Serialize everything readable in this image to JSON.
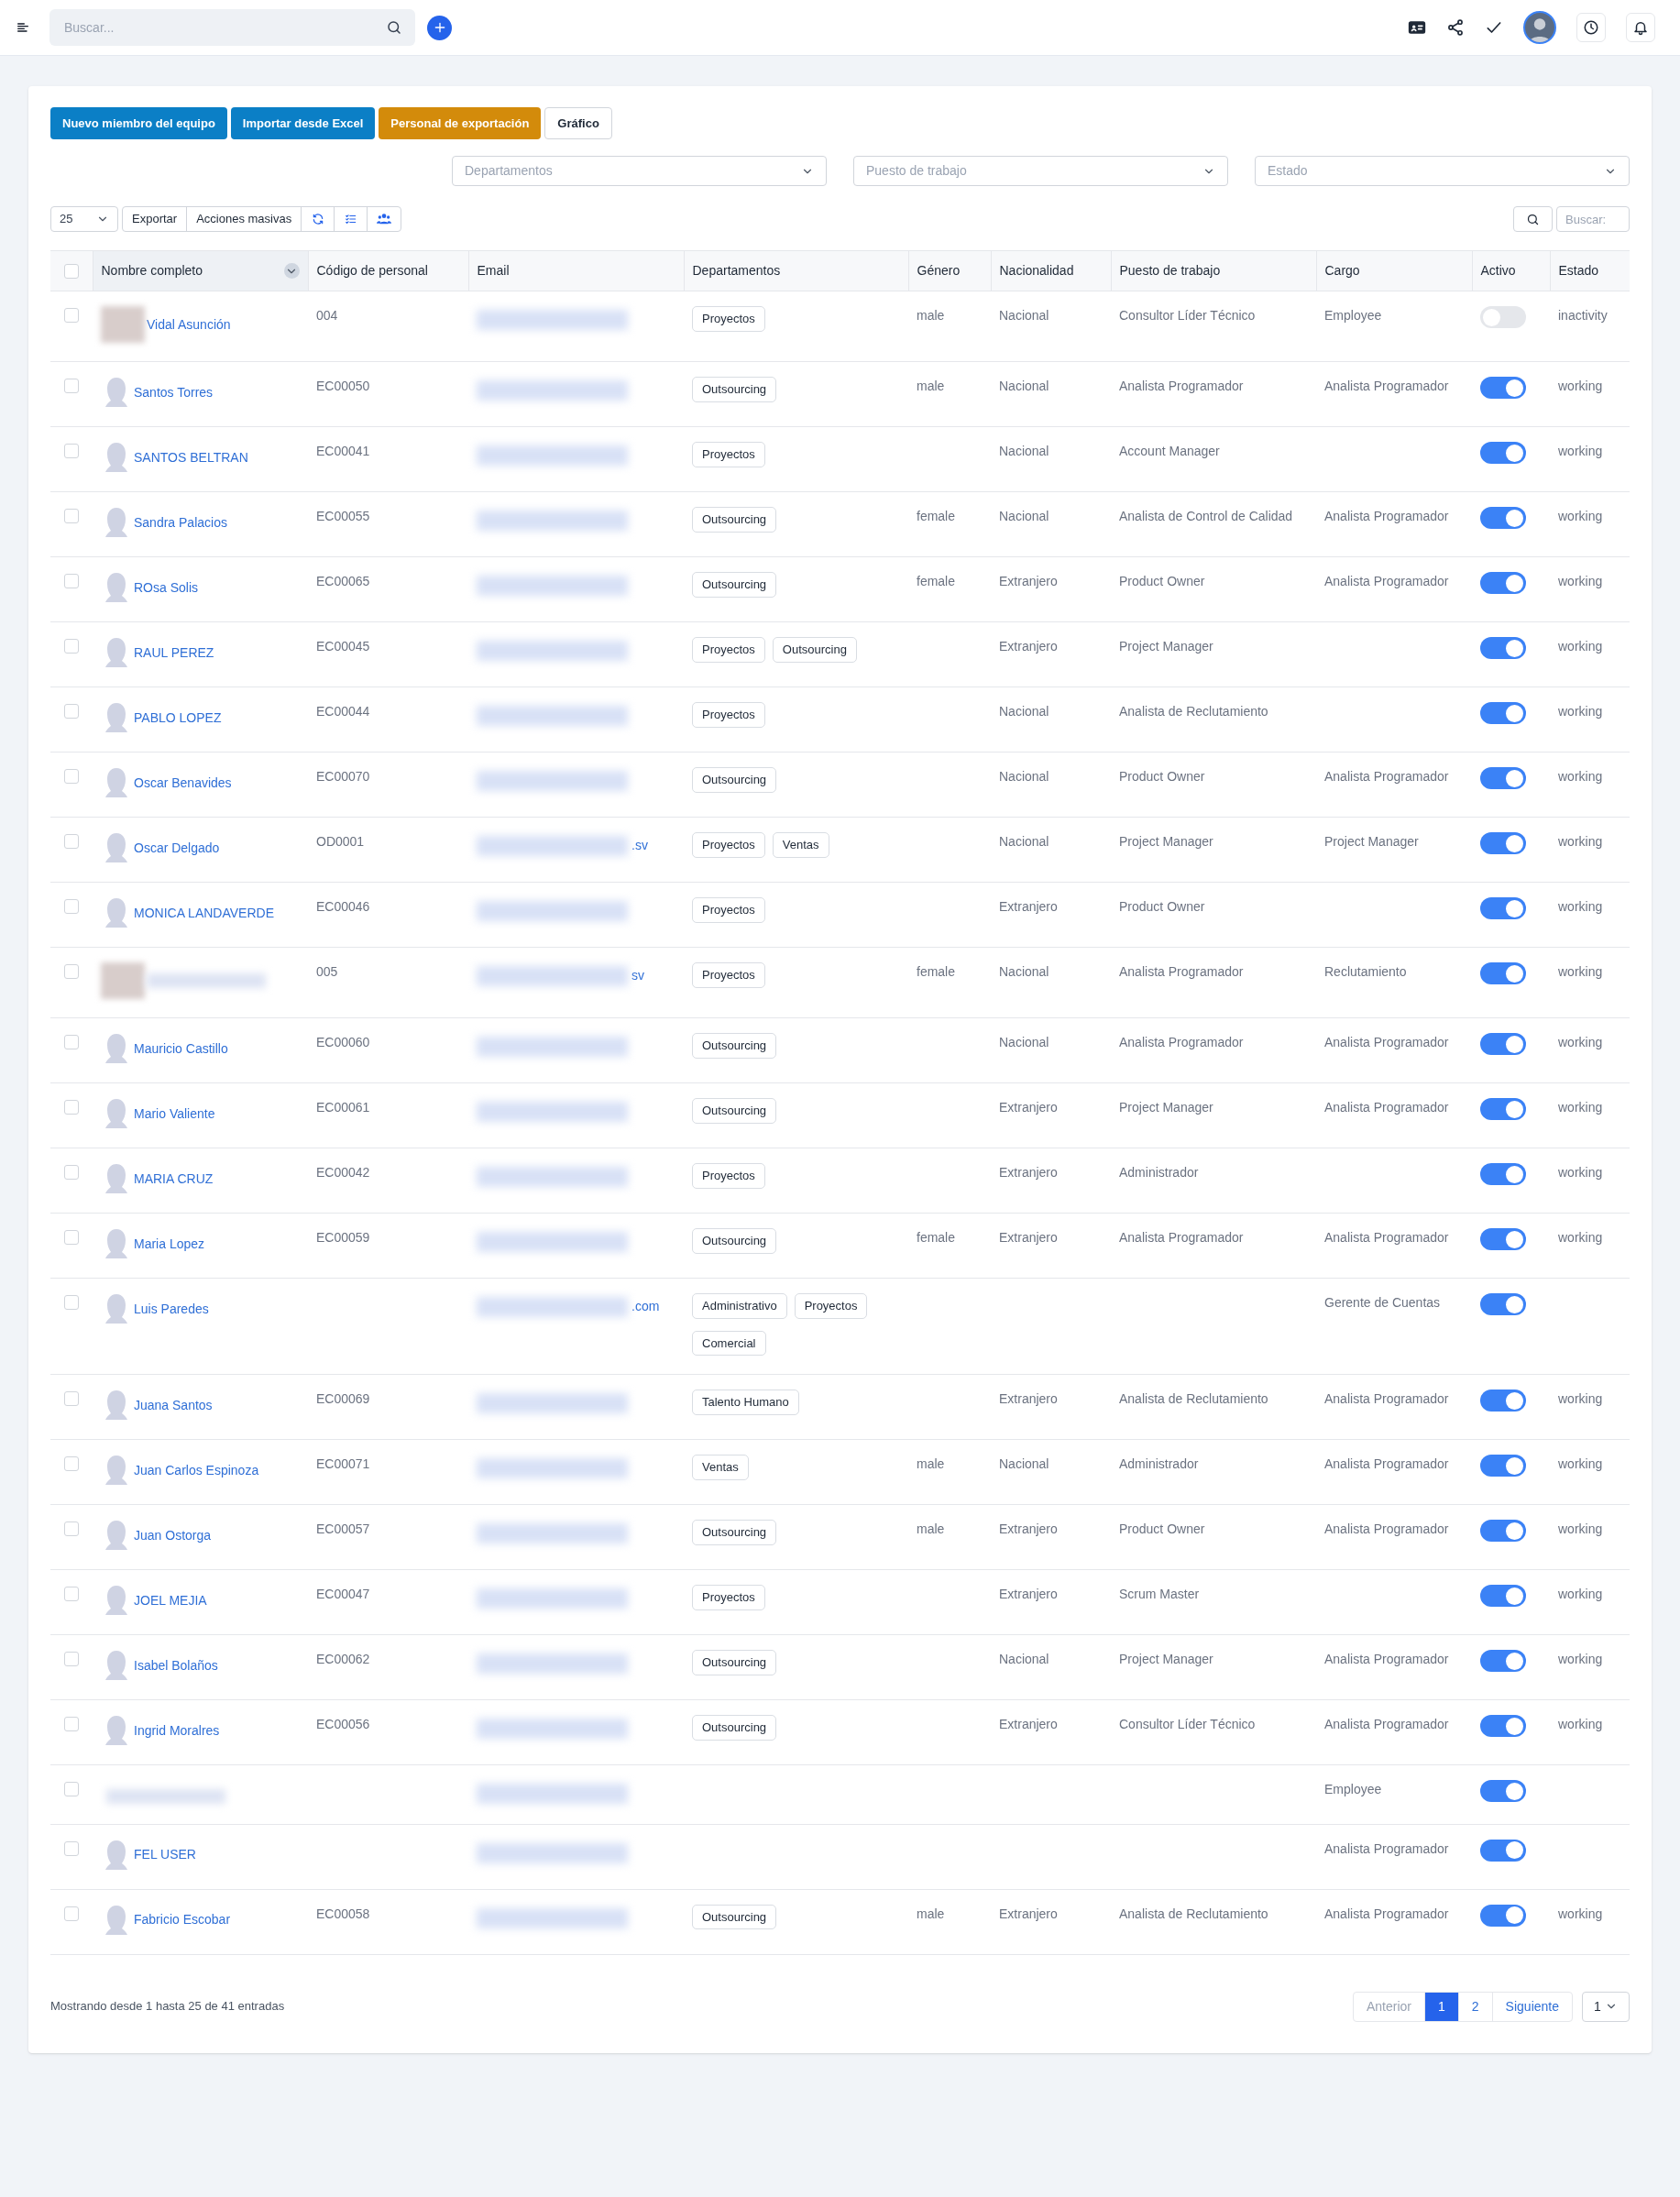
{
  "topbar": {
    "search": {
      "placeholder": "Buscar..."
    }
  },
  "actions": [
    {
      "label": "Nuevo miembro del equipo",
      "kind": "primary"
    },
    {
      "label": "Importar desde Excel",
      "kind": "primary"
    },
    {
      "label": "Personal de exportación",
      "kind": "warning"
    },
    {
      "label": "Gráfico",
      "kind": "plain"
    }
  ],
  "filters": [
    {
      "placeholder": "Departamentos"
    },
    {
      "placeholder": "Puesto de trabajo"
    },
    {
      "placeholder": "Estado"
    }
  ],
  "toolbar": {
    "page_size": "25",
    "buttons": [
      "Exportar",
      "Acciones masivas"
    ],
    "search": {
      "placeholder": "Buscar:"
    }
  },
  "table": {
    "columns": [
      "Nombre completo",
      "Código de personal",
      "Email",
      "Departamentos",
      "Género",
      "Nacionalidad",
      "Puesto de trabajo",
      "Cargo",
      "Activo",
      "Estado"
    ],
    "all_checked": false,
    "rows": [
      {
        "kind": "blurred",
        "name": "Vidal Asunción",
        "code": "004",
        "departments": [
          "Proyectos"
        ],
        "gender": "male",
        "nationality": "Nacional",
        "position": "Consultor Líder Técnico",
        "cargo": "Employee",
        "active": false,
        "status": "inactivity",
        "checked": false
      },
      {
        "kind": "default",
        "name": "Santos Torres",
        "code": "EC00050",
        "departments": [
          "Outsourcing"
        ],
        "gender": "male",
        "nationality": "Nacional",
        "position": "Analista Programador",
        "cargo": "Analista Programador",
        "active": true,
        "status": "working",
        "checked": false
      },
      {
        "kind": "default",
        "name": "SANTOS BELTRAN",
        "code": "EC00041",
        "departments": [
          "Proyectos"
        ],
        "nationality": "Nacional",
        "position": "Account Manager",
        "active": true,
        "status": "working",
        "checked": false
      },
      {
        "kind": "default",
        "name": "Sandra Palacios",
        "code": "EC00055",
        "departments": [
          "Outsourcing"
        ],
        "gender": "female",
        "nationality": "Nacional",
        "position": "Analista de Control de Calidad",
        "cargo": "Analista Programador",
        "active": true,
        "status": "working",
        "checked": false
      },
      {
        "kind": "default",
        "name": "ROsa Solis",
        "code": "EC00065",
        "departments": [
          "Outsourcing"
        ],
        "gender": "female",
        "nationality": "Extranjero",
        "position": "Product Owner",
        "cargo": "Analista Programador",
        "active": true,
        "status": "working",
        "checked": false
      },
      {
        "kind": "default",
        "name": "RAUL PEREZ",
        "code": "EC00045",
        "departments": [
          "Proyectos",
          "Outsourcing"
        ],
        "nationality": "Extranjero",
        "position": "Project Manager",
        "active": true,
        "status": "working",
        "checked": false
      },
      {
        "kind": "default",
        "name": "PABLO LOPEZ",
        "code": "EC00044",
        "departments": [
          "Proyectos"
        ],
        "nationality": "Nacional",
        "position": "Analista de Reclutamiento",
        "active": true,
        "status": "working",
        "checked": false
      },
      {
        "kind": "default",
        "name": "Oscar Benavides",
        "code": "EC00070",
        "departments": [
          "Outsourcing"
        ],
        "nationality": "Nacional",
        "position": "Product Owner",
        "cargo": "Analista Programador",
        "active": true,
        "status": "working",
        "checked": false
      },
      {
        "kind": "default",
        "name": "Oscar Delgado",
        "code": "OD0001",
        "email_tail": ".sv",
        "departments": [
          "Proyectos",
          "Ventas"
        ],
        "nationality": "Nacional",
        "position": "Project Manager",
        "cargo": "Project Manager",
        "active": true,
        "status": "working",
        "checked": false
      },
      {
        "kind": "default",
        "name": "MONICA LANDAVERDE",
        "code": "EC00046",
        "departments": [
          "Proyectos"
        ],
        "nationality": "Extranjero",
        "position": "Product Owner",
        "active": true,
        "status": "working",
        "checked": false
      },
      {
        "kind": "blurred",
        "code": "005",
        "email_tail": "sv",
        "departments": [
          "Proyectos"
        ],
        "gender": "female",
        "nationality": "Nacional",
        "position": "Analista Programador",
        "cargo": "Reclutamiento",
        "active": true,
        "status": "working",
        "checked": false
      },
      {
        "kind": "default",
        "name": "Mauricio Castillo",
        "code": "EC00060",
        "departments": [
          "Outsourcing"
        ],
        "nationality": "Nacional",
        "position": "Analista Programador",
        "cargo": "Analista Programador",
        "active": true,
        "status": "working",
        "checked": false
      },
      {
        "kind": "default",
        "name": "Mario Valiente",
        "code": "EC00061",
        "departments": [
          "Outsourcing"
        ],
        "nationality": "Extranjero",
        "position": "Project Manager",
        "cargo": "Analista Programador",
        "active": true,
        "status": "working",
        "checked": false
      },
      {
        "kind": "default",
        "name": "MARIA CRUZ",
        "code": "EC00042",
        "departments": [
          "Proyectos"
        ],
        "nationality": "Extranjero",
        "position": "Administrador",
        "active": true,
        "status": "working",
        "checked": false
      },
      {
        "kind": "default",
        "name": "Maria Lopez",
        "code": "EC00059",
        "departments": [
          "Outsourcing"
        ],
        "gender": "female",
        "nationality": "Extranjero",
        "position": "Analista Programador",
        "cargo": "Analista Programador",
        "active": true,
        "status": "working",
        "checked": false
      },
      {
        "kind": "default",
        "name": "Luis Paredes",
        "email_tail": ".com",
        "departments": [
          "Administrativo",
          "Proyectos",
          "Comercial"
        ],
        "cargo": "Gerente de Cuentas",
        "active": true,
        "checked": false
      },
      {
        "kind": "default",
        "name": "Juana Santos",
        "code": "EC00069",
        "departments": [
          "Talento Humano"
        ],
        "nationality": "Extranjero",
        "position": "Analista de Reclutamiento",
        "cargo": "Analista Programador",
        "active": true,
        "status": "working",
        "checked": false
      },
      {
        "kind": "default",
        "name": "Juan Carlos Espinoza",
        "code": "EC00071",
        "departments": [
          "Ventas"
        ],
        "gender": "male",
        "nationality": "Nacional",
        "position": "Administrador",
        "cargo": "Analista Programador",
        "active": true,
        "status": "working",
        "checked": false
      },
      {
        "kind": "default",
        "name": "Juan Ostorga",
        "code": "EC00057",
        "departments": [
          "Outsourcing"
        ],
        "gender": "male",
        "nationality": "Extranjero",
        "position": "Product Owner",
        "cargo": "Analista Programador",
        "active": true,
        "status": "working",
        "checked": false
      },
      {
        "kind": "default",
        "name": "JOEL MEJIA",
        "code": "EC00047",
        "departments": [
          "Proyectos"
        ],
        "nationality": "Extranjero",
        "position": "Scrum Master",
        "active": true,
        "status": "working",
        "checked": false
      },
      {
        "kind": "default",
        "name": "Isabel Bolaños",
        "code": "EC00062",
        "departments": [
          "Outsourcing"
        ],
        "nationality": "Nacional",
        "position": "Project Manager",
        "cargo": "Analista Programador",
        "active": true,
        "status": "working",
        "checked": false
      },
      {
        "kind": "default",
        "name": "Ingrid Moralres",
        "code": "EC00056",
        "departments": [
          "Outsourcing"
        ],
        "nationality": "Extranjero",
        "position": "Consultor Líder Técnico",
        "cargo": "Analista Programador",
        "active": true,
        "status": "working",
        "checked": false
      },
      {
        "kind": "none",
        "cargo": "Employee",
        "active": true,
        "checked": false
      },
      {
        "kind": "default",
        "name": "FEL USER",
        "cargo": "Analista Programador",
        "active": true,
        "checked": false
      },
      {
        "kind": "default",
        "name": "Fabricio Escobar",
        "code": "EC00058",
        "departments": [
          "Outsourcing"
        ],
        "gender": "male",
        "nationality": "Extranjero",
        "position": "Analista de Reclutamiento",
        "cargo": "Analista Programador",
        "active": true,
        "status": "working",
        "checked": false
      }
    ]
  },
  "footer": {
    "summary": "Mostrando desde 1 hasta 25 de 41 entradas",
    "pagination": [
      {
        "label": "Anterior",
        "kind": "prev",
        "disabled": true
      },
      {
        "label": "1",
        "kind": "page",
        "selected": true
      },
      {
        "label": "2",
        "kind": "page",
        "selected": false
      },
      {
        "label": "Siguiente",
        "kind": "next",
        "disabled": false
      }
    ],
    "page_select": "1"
  }
}
